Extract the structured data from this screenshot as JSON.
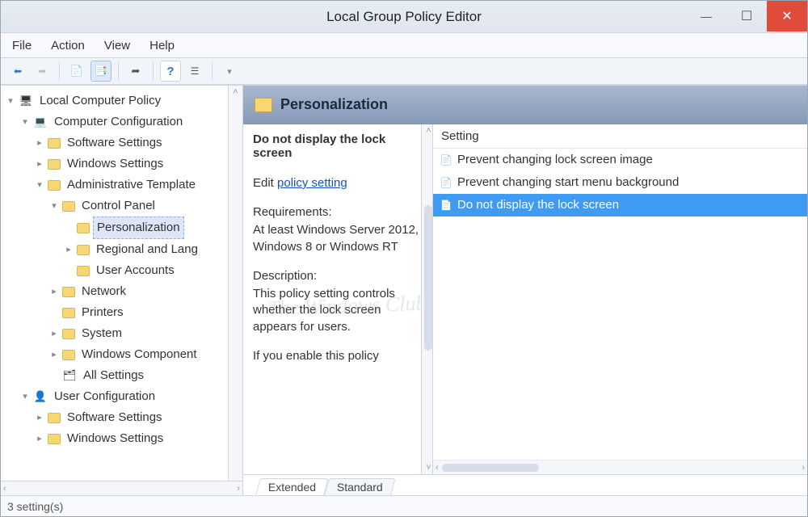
{
  "window": {
    "title": "Local Group Policy Editor"
  },
  "menu": {
    "file": "File",
    "action": "Action",
    "view": "View",
    "help": "Help"
  },
  "tree": {
    "root": "Local Computer Policy",
    "comp_conf": "Computer Configuration",
    "cc_soft": "Software Settings",
    "cc_win": "Windows Settings",
    "cc_admin": "Administrative Template",
    "cp": "Control Panel",
    "cp_pers": "Personalization",
    "cp_regl": "Regional and Lang",
    "cp_user": "User Accounts",
    "net": "Network",
    "prn": "Printers",
    "sys": "System",
    "wcomp": "Windows Component",
    "allset": "All Settings",
    "user_conf": "User Configuration",
    "uc_soft": "Software Settings",
    "uc_win": "Windows Settings"
  },
  "header": {
    "title": "Personalization"
  },
  "desc": {
    "title": "Do not display the lock screen",
    "edit_prefix": "Edit ",
    "edit_link": "policy setting",
    "req_h": "Requirements:",
    "req_body": "At least Windows Server 2012, Windows 8 or Windows RT",
    "desc_h": "Description:",
    "desc_body": "This policy setting controls whether the lock screen appears for users.",
    "desc_more": "If you enable this policy"
  },
  "list": {
    "col": "Setting",
    "r0": "Prevent changing lock screen image",
    "r1": "Prevent changing start menu background",
    "r2": "Do not display the lock screen"
  },
  "tabs": {
    "ext": "Extended",
    "std": "Standard"
  },
  "status": {
    "text": "3 setting(s)"
  },
  "watermark": "The Windows Club"
}
